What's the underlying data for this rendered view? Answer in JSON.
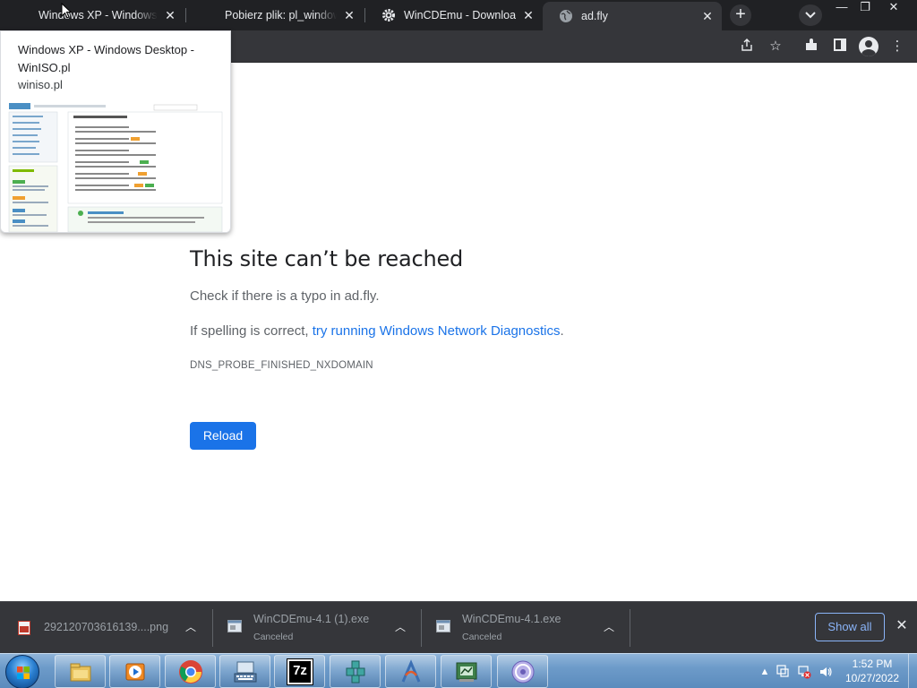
{
  "browser": {
    "tabs": [
      {
        "title": "Windows XP - Windows Desktop - WinISO.pl",
        "favicon": "windows-logo-icon",
        "active": false
      },
      {
        "title": "Pobierz plik: pl_windows_xp",
        "favicon": "windows-logo-icon",
        "active": false
      },
      {
        "title": "WinCDEmu - Download",
        "favicon": "gear-icon",
        "active": false
      },
      {
        "title": "ad.fly",
        "favicon": "globe-icon",
        "active": true
      }
    ],
    "new_tab_label": "+",
    "window_controls": {
      "minimize": "—",
      "restore": "❐",
      "close": "✕"
    }
  },
  "hover_card": {
    "title": "Windows XP - Windows Desktop - WinISO.pl",
    "domain": "winiso.pl"
  },
  "error_page": {
    "heading": "This site can’t be reached",
    "line1": "Check if there is a typo in ad.fly.",
    "line2_prefix": "If spelling is correct, ",
    "line2_link": "try running Windows Network Diagnostics",
    "line2_suffix": ".",
    "error_code": "DNS_PROBE_FINISHED_NXDOMAIN",
    "reload_label": "Reload"
  },
  "downloads": {
    "items": [
      {
        "name": "292120703616139....png",
        "status": "",
        "icon": "image-file-icon"
      },
      {
        "name": "WinCDEmu-4.1 (1).exe",
        "status": "Canceled",
        "icon": "exe-file-icon"
      },
      {
        "name": "WinCDEmu-4.1.exe",
        "status": "Canceled",
        "icon": "exe-file-icon"
      }
    ],
    "show_all_label": "Show all"
  },
  "taskbar": {
    "apps": [
      "file-explorer-icon",
      "media-player-icon",
      "chrome-icon",
      "keyboard-app-icon",
      "7zip-icon",
      "cubes-app-icon",
      "antenna-app-icon",
      "chip-app-icon",
      "cd-emulator-icon"
    ],
    "apps_7zip_label": "7z",
    "clock_time": "1:52 PM",
    "clock_date": "10/27/2022"
  },
  "colors": {
    "tab_strip": "#202124",
    "toolbar": "#35363a",
    "link": "#1a73e8",
    "reload_button": "#1a73e8",
    "taskbar": "#6d9bc9"
  }
}
